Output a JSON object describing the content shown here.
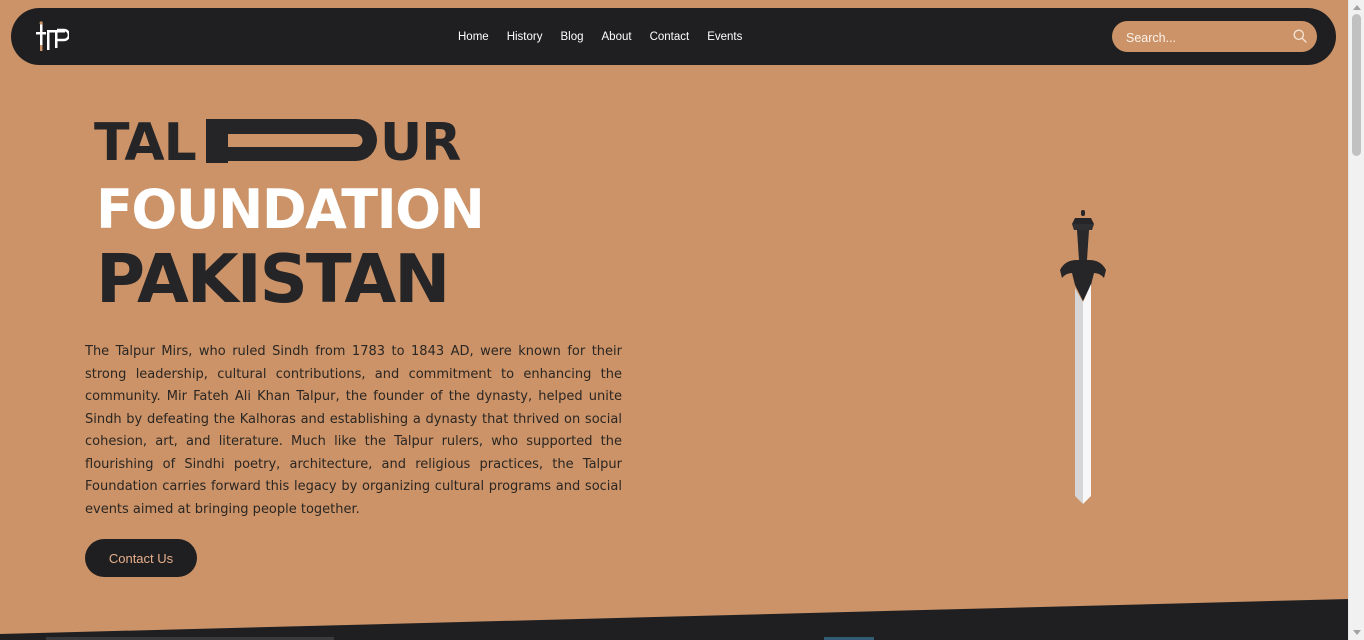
{
  "brand": {
    "logo_icon": "tfp-monogram-logo-icon"
  },
  "nav": {
    "links": [
      "Home",
      "History",
      "Blog",
      "About",
      "Contact",
      "Events"
    ]
  },
  "search": {
    "placeholder": "Search...",
    "icon": "search-icon"
  },
  "hero": {
    "title_line1_left": "TAL",
    "title_line1_right": "UR",
    "title_line2": "FOUNDATION",
    "title_line3": "PAKISTAN",
    "intro": "The Talpur Mirs, who ruled Sindh from 1783 to 1843 AD, were known for their strong leadership, cultural contributions, and commitment to enhancing the community. Mir Fateh Ali Khan Talpur, the founder of the dynasty, helped unite Sindh by defeating the Kalhoras and establishing a dynasty that thrived on social cohesion, art, and literature. Much like the Talpur rulers, who supported the flourishing of Sindhi poetry, architecture, and religious practices, the Talpur Foundation carries forward this legacy by organizing cultural programs and social events aimed at bringing people together.",
    "cta_label": "Contact Us",
    "illustration": "sword-icon"
  },
  "colors": {
    "background": "#cb9367",
    "dark": "#1f1f22",
    "text": "#2b2623",
    "white": "#ffffff",
    "cta_text": "#e8b08a"
  }
}
